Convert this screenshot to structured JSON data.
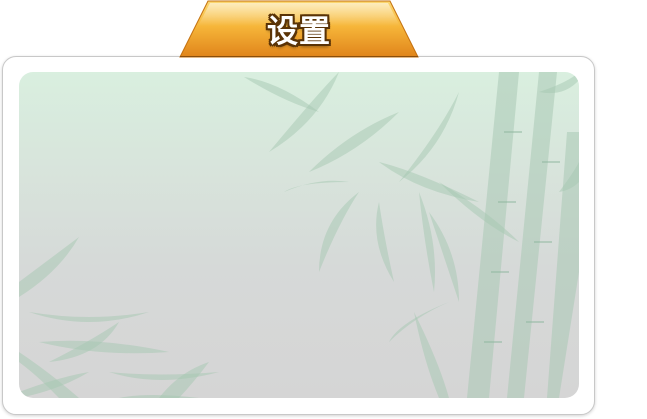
{
  "dialog": {
    "title": "设置"
  },
  "colors": {
    "tab_top": "#f9c547",
    "tab_bottom": "#e4891c",
    "panel_top": "#d9efdf",
    "panel_bottom": "#d5d5d5",
    "bamboo": "#a8c8b4"
  },
  "background": {
    "decoration": "bamboo-illustration"
  }
}
